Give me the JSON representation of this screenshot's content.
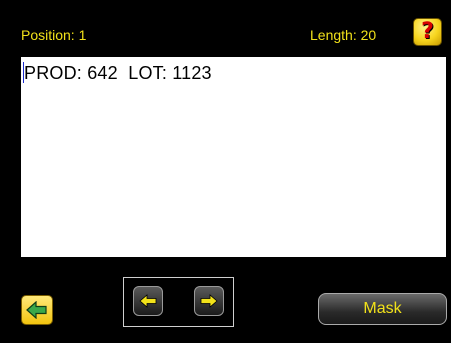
{
  "header": {
    "position_text": "Position: 1",
    "length_text": "Length: 20",
    "help_icon": "question-mark-icon",
    "help_glyph": "?"
  },
  "editor": {
    "value": "PROD: 642  LOT: 1123"
  },
  "footer": {
    "home_icon": "back-arrow-icon",
    "left_icon": "arrow-left-icon",
    "right_icon": "arrow-right-icon",
    "mask_label": "Mask"
  },
  "colors": {
    "background": "#000000",
    "label_text": "#f2e21a",
    "help_button": "#f7d51e",
    "help_glyph": "#d60000",
    "home_button": "#f2c40f",
    "home_arrow": "#3aa84a",
    "cursor": "#1b2bd0"
  }
}
